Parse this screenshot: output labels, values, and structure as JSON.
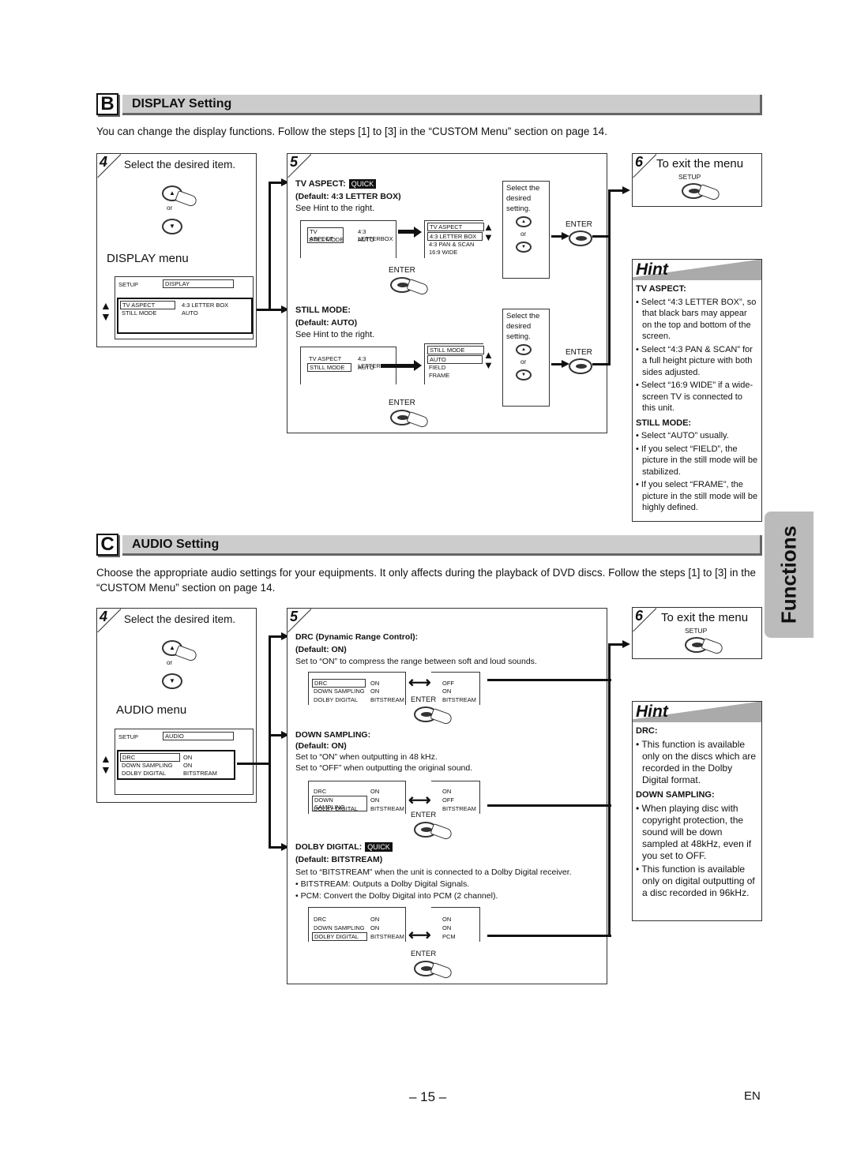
{
  "display": {
    "letter": "B",
    "title": "DISPLAY Setting",
    "intro": "You can change the display functions. Follow the steps [1] to [3] in the “CUSTOM Menu” section on page 14.",
    "step4": {
      "num": "4",
      "title": "Select the desired item.",
      "or": "or",
      "menu_title": "DISPLAY menu",
      "menu": {
        "setup": "SETUP",
        "tab": "DISPLAY",
        "rows": [
          {
            "item": "TV ASPECT",
            "value": "4:3 LETTER BOX"
          },
          {
            "item": "STILL MODE",
            "value": "AUTO"
          }
        ]
      }
    },
    "step5": {
      "num": "5",
      "tv_aspect": {
        "heading": "TV ASPECT:",
        "badge": "QUICK",
        "default": "(Default: 4:3 LETTER BOX)",
        "note": "See Hint to the right.",
        "menu_rows": [
          {
            "item": "TV ASPECT",
            "value": "4:3 LETTERBOX"
          },
          {
            "item": "STILL MODE",
            "value": "AUTO"
          }
        ],
        "submenu_title": "TV ASPECT",
        "options": [
          "4:3 LETTER BOX",
          "4:3 PAN & SCAN",
          "16:9 WIDE"
        ],
        "select_text": "Select the desired setting.",
        "or": "or",
        "enter": "ENTER",
        "enter2": "ENTER"
      },
      "still_mode": {
        "heading": "STILL MODE:",
        "default": "(Default: AUTO)",
        "note": "See Hint to the right.",
        "menu_rows": [
          {
            "item": "TV ASPECT",
            "value": "4:3 LETTERBOX"
          },
          {
            "item": "STILL MODE",
            "value": "AUTO"
          }
        ],
        "submenu_title": "STILL MODE",
        "options": [
          "AUTO",
          "FIELD",
          "FRAME"
        ],
        "select_text": "Select the desired setting.",
        "or": "or",
        "enter": "ENTER",
        "enter2": "ENTER"
      }
    },
    "step6": {
      "num": "6",
      "title": "To exit the menu",
      "button": "SETUP"
    },
    "hint": {
      "title": "Hint",
      "sections": [
        {
          "heading": "TV ASPECT:",
          "items": [
            "Select “4:3 LETTER BOX”, so that black bars may appear on the top and bottom of the screen.",
            "Select “4:3 PAN & SCAN” for a full height picture with both sides adjusted.",
            "Select “16:9 WIDE” if a wide-screen TV is connected to this unit."
          ]
        },
        {
          "heading": "STILL MODE:",
          "items": [
            "Select “AUTO” usually.",
            "If you select “FIELD”, the picture in the still mode will be stabilized.",
            "If you select “FRAME”, the picture in the still mode will be highly defined."
          ]
        }
      ]
    }
  },
  "audio": {
    "letter": "C",
    "title": "AUDIO Setting",
    "intro": "Choose the appropriate audio settings for your equipments. It only affects during the playback of DVD discs. Follow the steps [1] to [3] in the “CUSTOM Menu” section on page 14.",
    "step4": {
      "num": "4",
      "title": "Select the desired item.",
      "or": "or",
      "menu_title": "AUDIO menu",
      "menu": {
        "setup": "SETUP",
        "tab": "AUDIO",
        "rows": [
          {
            "item": "DRC",
            "value": "ON"
          },
          {
            "item": "DOWN SAMPLING",
            "value": "ON"
          },
          {
            "item": "DOLBY DIGITAL",
            "value": "BITSTREAM"
          }
        ]
      }
    },
    "step5": {
      "num": "5",
      "drc": {
        "heading": "DRC (Dynamic Range Control):",
        "default": "(Default: ON)",
        "lines": [
          "Set to “ON” to compress the range between soft and loud sounds."
        ],
        "rows": [
          {
            "item": "DRC",
            "value": "ON",
            "alt": "OFF"
          },
          {
            "item": "DOWN SAMPLING",
            "value": "ON",
            "alt": "ON"
          },
          {
            "item": "DOLBY DIGITAL",
            "value": "BITSTREAM",
            "alt": "BITSTREAM"
          }
        ],
        "enter": "ENTER"
      },
      "down_sampling": {
        "heading": "DOWN SAMPLING:",
        "default": "(Default: ON)",
        "lines": [
          "Set to “ON” when outputting in 48 kHz.",
          "Set to “OFF” when outputting the original sound."
        ],
        "rows": [
          {
            "item": "DRC",
            "value": "ON",
            "alt": "ON"
          },
          {
            "item": "DOWN SAMPLING",
            "value": "ON",
            "alt": "OFF"
          },
          {
            "item": "DOLBY DIGITAL",
            "value": "BITSTREAM",
            "alt": "BITSTREAM"
          }
        ],
        "enter": "ENTER"
      },
      "dolby_digital": {
        "heading": "DOLBY DIGITAL:",
        "badge": "QUICK",
        "default": "(Default: BITSTREAM)",
        "lines": [
          "Set to “BITSTREAM” when the unit is connected to a Dolby Digital receiver.",
          "• BITSTREAM: Outputs a Dolby Digital Signals.",
          "• PCM: Convert the Dolby Digital into PCM (2 channel)."
        ],
        "rows": [
          {
            "item": "DRC",
            "value": "ON",
            "alt": "ON"
          },
          {
            "item": "DOWN SAMPLING",
            "value": "ON",
            "alt": "ON"
          },
          {
            "item": "DOLBY DIGITAL",
            "value": "BITSTREAM",
            "alt": "PCM"
          }
        ],
        "enter": "ENTER"
      }
    },
    "step6": {
      "num": "6",
      "title": "To exit the menu",
      "button": "SETUP"
    },
    "hint": {
      "title": "Hint",
      "sections": [
        {
          "heading": "DRC:",
          "items": [
            "This function is available only on the discs which are recorded in the Dolby Digital format."
          ]
        },
        {
          "heading": "DOWN SAMPLING:",
          "items": [
            "When playing disc with copyright protection, the sound will be down sampled at 48kHz, even if you set to OFF.",
            "This function is available only on digital outputting of a disc recorded in 96kHz."
          ]
        }
      ]
    }
  },
  "side_tab": "Functions",
  "footer": {
    "page": "– 15 –",
    "lang": "EN"
  }
}
